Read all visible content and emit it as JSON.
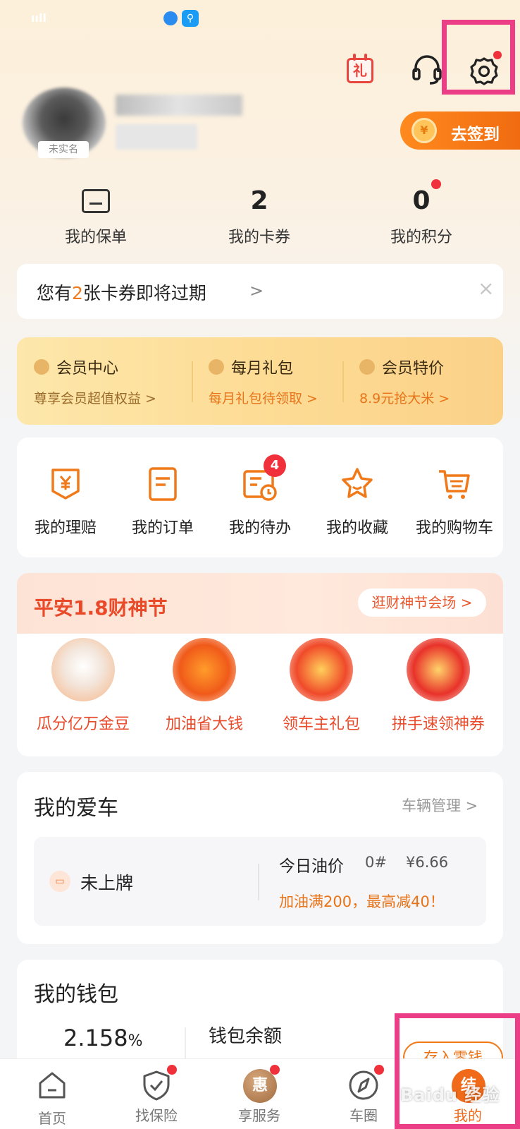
{
  "status_bar": {
    "signal": "ııll"
  },
  "header": {
    "gift_icon_char": "礼"
  },
  "profile": {
    "avatar_tag": "未实名",
    "signin_label": "去签到",
    "signin_coin": "¥"
  },
  "stats": [
    {
      "value": "",
      "label": "我的保单"
    },
    {
      "value": "2",
      "label": "我的卡券"
    },
    {
      "value": "0",
      "label": "我的积分"
    }
  ],
  "notice": {
    "prefix": "您有",
    "count": "2",
    "suffix": "张卡券即将过期",
    "arrow": ">",
    "close": "×"
  },
  "member": [
    {
      "title": "会员中心",
      "sub": "尊享会员超值权益 >"
    },
    {
      "title": "每月礼包",
      "sub": "每月礼包待领取 >"
    },
    {
      "title": "会员特价",
      "sub": "8.9元抢大米 >"
    }
  ],
  "services": {
    "items": [
      {
        "label": "我的理赔"
      },
      {
        "label": "我的订单"
      },
      {
        "label": "我的待办"
      },
      {
        "label": "我的收藏"
      },
      {
        "label": "我的购物车"
      }
    ],
    "todo_badge": "4"
  },
  "festival": {
    "title": "平安1.8财神节",
    "link": "逛财神节会场 >",
    "items": [
      {
        "label": "瓜分亿万金豆"
      },
      {
        "label": "加油省大钱"
      },
      {
        "label": "领车主礼包"
      },
      {
        "label": "拼手速领神券"
      }
    ]
  },
  "car": {
    "title": "我的爱车",
    "manage": "车辆管理 >",
    "plate": "未上牌",
    "oil_label": "今日油价",
    "oil_type": "0#",
    "oil_price": "¥6.66",
    "oil_promo": "加油满200，最高减40！"
  },
  "wallet": {
    "title": "我的钱包",
    "rate": "2.158",
    "rate_unit": "%",
    "balance_label": "钱包余额",
    "deposit": "存入零钱"
  },
  "tabbar": [
    {
      "label": "首页"
    },
    {
      "label": "找保险"
    },
    {
      "label": "享服务",
      "icon_text": "惠"
    },
    {
      "label": "车圈"
    },
    {
      "label": "我的",
      "icon_text": "结"
    }
  ],
  "watermark": "Baidu 经验",
  "colors": {
    "accent": "#f06a1a",
    "badge": "#f0303a",
    "highlight": "#ec3e86"
  }
}
